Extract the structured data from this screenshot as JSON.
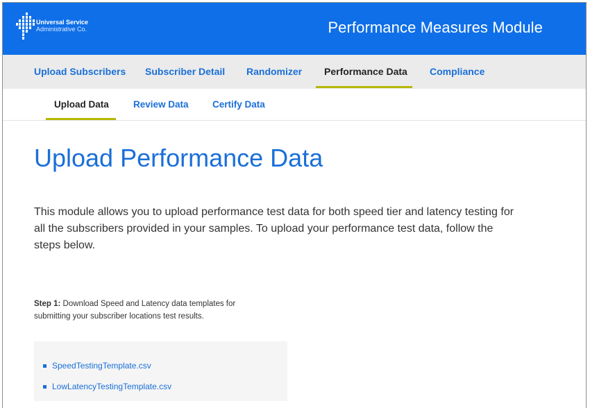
{
  "brand": {
    "line1": "Universal Service",
    "line2": "Administrative Co.",
    "colors": {
      "primary": "#0f6fe8",
      "link": "#1a6fd8",
      "accent_underline": "#b5b800"
    }
  },
  "header": {
    "app_title": "Performance Measures Module"
  },
  "main_nav": {
    "items": [
      {
        "label": "Upload Subscribers"
      },
      {
        "label": "Subscriber Detail"
      },
      {
        "label": "Randomizer"
      },
      {
        "label": "Performance Data",
        "active": true
      },
      {
        "label": "Compliance"
      }
    ]
  },
  "sub_nav": {
    "items": [
      {
        "label": "Upload Data",
        "active": true
      },
      {
        "label": "Review Data"
      },
      {
        "label": "Certify Data"
      }
    ]
  },
  "page": {
    "title": "Upload Performance Data",
    "intro": "This module allows you to upload performance test data for both speed tier and latency testing for all the subscribers provided in your samples. To upload your performance test data, follow the steps below.",
    "step1_label": "Step 1:",
    "step1_text": " Download Speed and Latency data templates for submitting your subscriber locations test results.",
    "files": [
      {
        "name": "SpeedTestingTemplate.csv"
      },
      {
        "name": "LowLatencyTestingTemplate.csv"
      }
    ]
  }
}
